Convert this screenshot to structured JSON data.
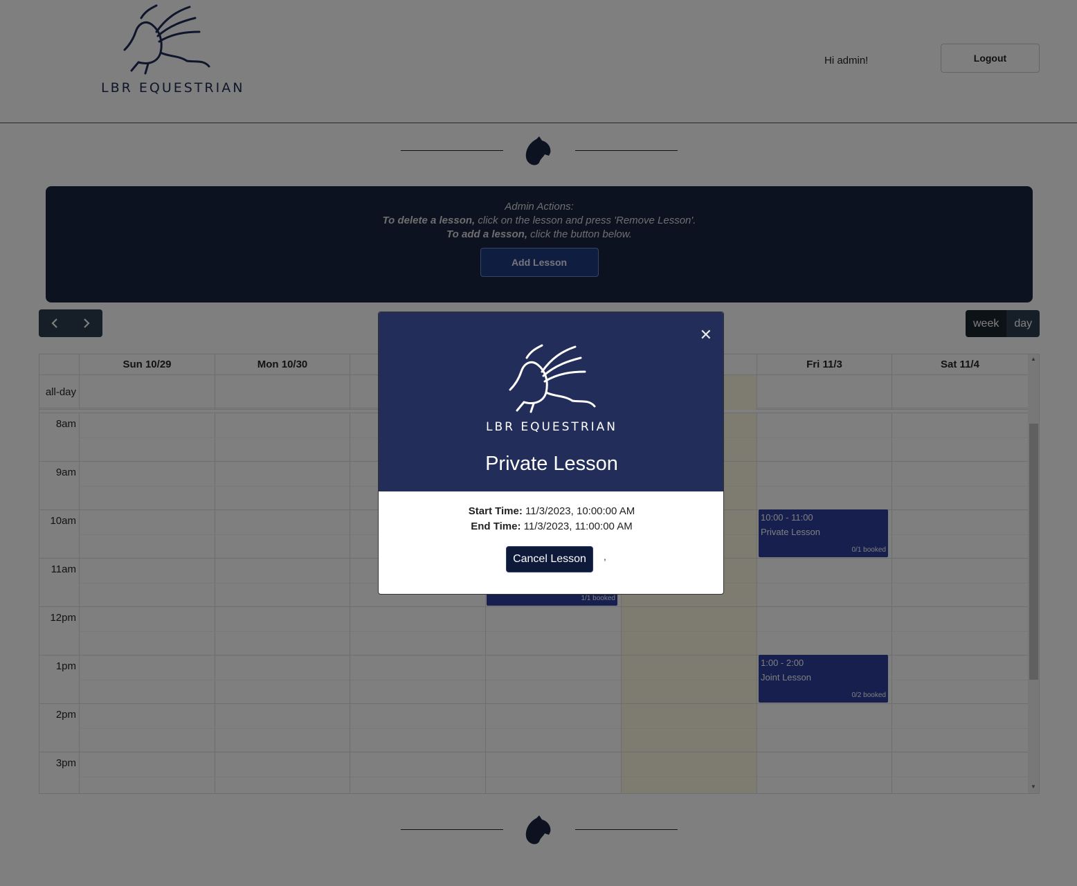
{
  "header": {
    "logo_text": "LBR EQUESTRIAN",
    "greeting": "Hi admin!",
    "logout_label": "Logout"
  },
  "admin": {
    "line1": "Admin Actions:",
    "line2_bold": "To delete a lesson,",
    "line2_rest": " click on the lesson and press 'Remove Lesson'.",
    "line3_bold": "To add a lesson,",
    "line3_rest": " click the button below.",
    "add_label": "Add Lesson"
  },
  "toolbar": {
    "prev_icon": "chevron-left-icon",
    "next_icon": "chevron-right-icon",
    "view_week": "week",
    "view_day": "day"
  },
  "calendar": {
    "days": [
      "Sun 10/29",
      "Mon 10/30",
      "",
      "",
      "",
      "Fri 11/3",
      "Sat 11/4"
    ],
    "allday_label": "all-day",
    "hours": [
      "8am",
      "9am",
      "10am",
      "11am",
      "12pm",
      "1pm",
      "2pm",
      "3pm"
    ],
    "events": [
      {
        "time": "10:00 - 11:00",
        "title": "Private Lesson",
        "booked": "0/1 booked"
      },
      {
        "time": "1:00 - 2:00",
        "title": "Joint Lesson",
        "booked": "0/2 booked"
      },
      {
        "booked": "1/1 booked"
      }
    ]
  },
  "modal": {
    "logo_text": "LBR EQUESTRIAN",
    "title": "Private Lesson",
    "start_label": "Start Time:",
    "start_value": " 11/3/2023, 10:00:00 AM",
    "end_label": "End Time:",
    "end_value": " 11/3/2023, 11:00:00 AM",
    "cancel_label": "Cancel Lesson",
    "comma": ","
  },
  "colors": {
    "navy": "#222d5a",
    "event_blue": "#2c3e9c",
    "today": "#fcf8e3"
  }
}
